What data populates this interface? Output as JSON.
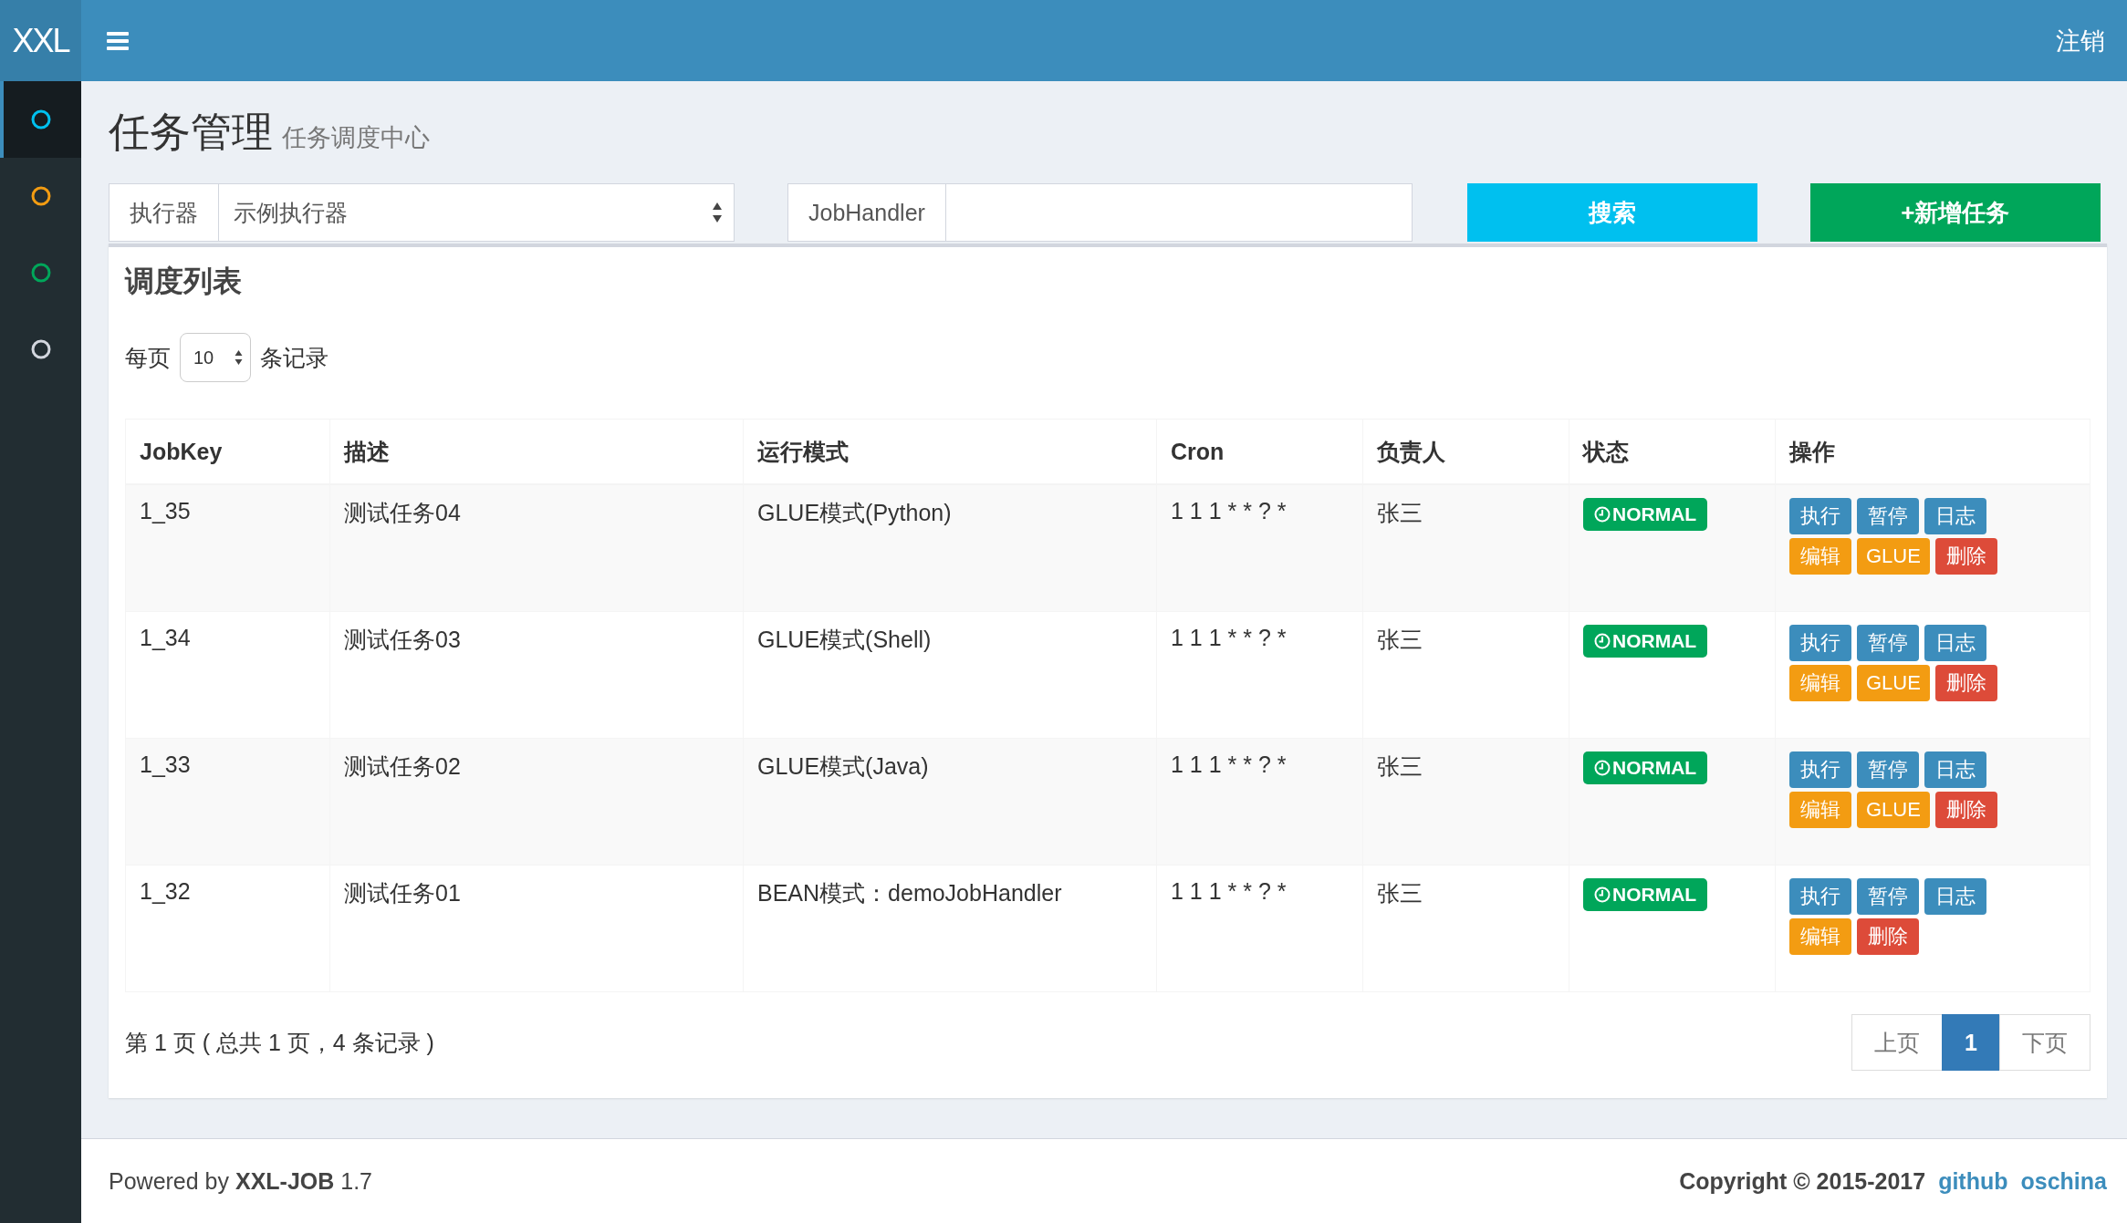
{
  "logo": "XXL",
  "logout": "注销",
  "sidebar": [
    {
      "color": "#00c0ef",
      "selected": true
    },
    {
      "color": "#f39c12",
      "selected": false
    },
    {
      "color": "#00a65a",
      "selected": false
    },
    {
      "color": "#d2d6de",
      "selected": false
    }
  ],
  "page": {
    "title": "任务管理",
    "subtitle": "任务调度中心"
  },
  "filters": {
    "executor_label": "执行器",
    "executor_value": "示例执行器",
    "handler_label": "JobHandler",
    "search": "搜索",
    "add": "+新增任务"
  },
  "box": {
    "title": "调度列表",
    "page_size_prefix": "每页",
    "page_size": "10",
    "page_size_suffix": "条记录"
  },
  "table": {
    "columns": [
      "JobKey",
      "描述",
      "运行模式",
      "Cron",
      "负责人",
      "状态",
      "操作"
    ],
    "rows": [
      {
        "key": "1_35",
        "desc": "测试任务04",
        "mode": "GLUE模式(Python)",
        "cron": "1 1 1 * * ? *",
        "owner": "张三",
        "status": "NORMAL",
        "actions": [
          {
            "label": "执行",
            "kind": "primary"
          },
          {
            "label": "暂停",
            "kind": "primary"
          },
          {
            "label": "日志",
            "kind": "primary"
          },
          {
            "label": "编辑",
            "kind": "warning"
          },
          {
            "label": "GLUE",
            "kind": "warning"
          },
          {
            "label": "删除",
            "kind": "danger"
          }
        ]
      },
      {
        "key": "1_34",
        "desc": "测试任务03",
        "mode": "GLUE模式(Shell)",
        "cron": "1 1 1 * * ? *",
        "owner": "张三",
        "status": "NORMAL",
        "actions": [
          {
            "label": "执行",
            "kind": "primary"
          },
          {
            "label": "暂停",
            "kind": "primary"
          },
          {
            "label": "日志",
            "kind": "primary"
          },
          {
            "label": "编辑",
            "kind": "warning"
          },
          {
            "label": "GLUE",
            "kind": "warning"
          },
          {
            "label": "删除",
            "kind": "danger"
          }
        ]
      },
      {
        "key": "1_33",
        "desc": "测试任务02",
        "mode": "GLUE模式(Java)",
        "cron": "1 1 1 * * ? *",
        "owner": "张三",
        "status": "NORMAL",
        "actions": [
          {
            "label": "执行",
            "kind": "primary"
          },
          {
            "label": "暂停",
            "kind": "primary"
          },
          {
            "label": "日志",
            "kind": "primary"
          },
          {
            "label": "编辑",
            "kind": "warning"
          },
          {
            "label": "GLUE",
            "kind": "warning"
          },
          {
            "label": "删除",
            "kind": "danger"
          }
        ]
      },
      {
        "key": "1_32",
        "desc": "测试任务01",
        "mode": "BEAN模式：demoJobHandler",
        "cron": "1 1 1 * * ? *",
        "owner": "张三",
        "status": "NORMAL",
        "actions": [
          {
            "label": "执行",
            "kind": "primary"
          },
          {
            "label": "暂停",
            "kind": "primary"
          },
          {
            "label": "日志",
            "kind": "primary"
          },
          {
            "label": "编辑",
            "kind": "warning"
          },
          {
            "label": "删除",
            "kind": "danger"
          }
        ]
      }
    ]
  },
  "info": "第 1 页 ( 总共 1 页，4 条记录 )",
  "pagination": [
    {
      "label": "上页",
      "selected": false
    },
    {
      "label": "1",
      "selected": true
    },
    {
      "label": "下页",
      "selected": false
    }
  ],
  "footer": {
    "powered": "Powered by **XXL-JOB** 1.7",
    "copyright": "Copyright © 2015-2017",
    "links": [
      "github",
      "oschina"
    ]
  }
}
